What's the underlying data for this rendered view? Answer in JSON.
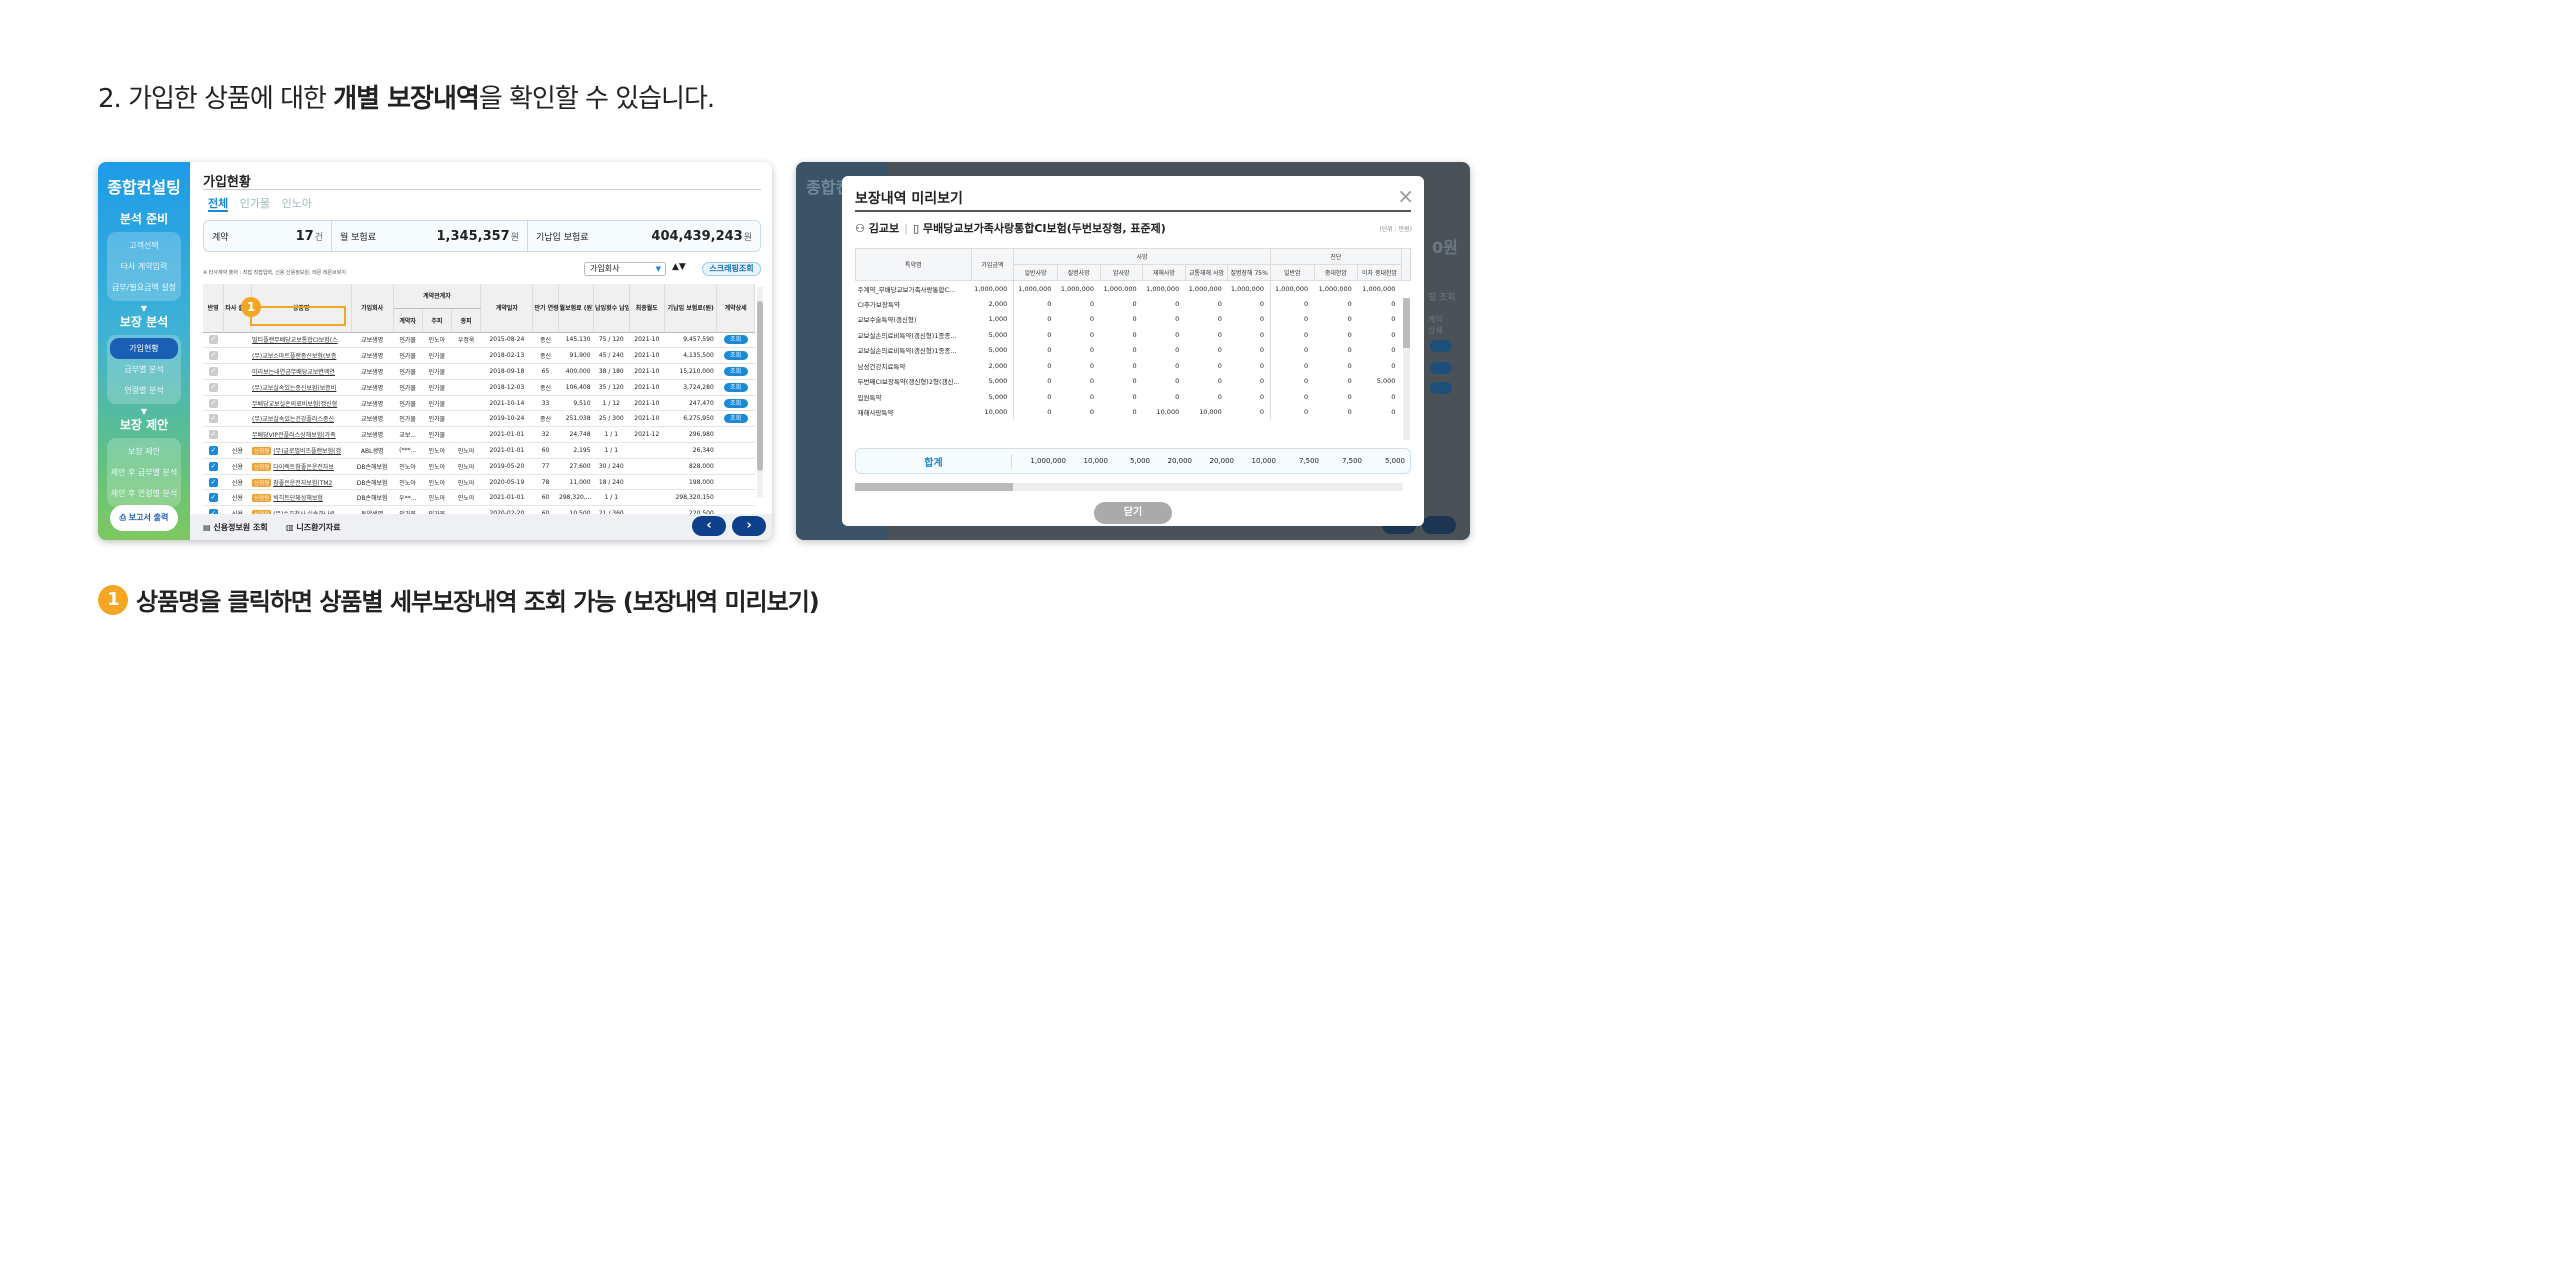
{
  "heading": {
    "prefix": "2. 가입한 상품에 대한 ",
    "bold": "개별 보장내역",
    "suffix": "을 확인할 수 있습니다."
  },
  "footnote": {
    "num": "1",
    "text": "상품명을 클릭하면 상품별 세부보장내역 조회 가능 (보장내역 미리보기)"
  },
  "sidebar": {
    "title": "종합컨설팅",
    "sections": [
      {
        "title": "분석 준비",
        "items": [
          "고객선택",
          "타사 계약입력",
          "급부/필요금액 설정"
        ]
      },
      {
        "title": "보장 분석",
        "items": [
          "가입현황",
          "급부별 분석",
          "연령별 분석"
        ]
      },
      {
        "title": "보장 제안",
        "items": [
          "보장 제안",
          "제안 후 급부별 분석",
          "제안 후 연령별 분석"
        ]
      }
    ],
    "active": "가입현황",
    "print": "보고서 출력"
  },
  "content": {
    "title": "가입현황",
    "tabs": [
      "전체",
      "인가물",
      "인노아"
    ],
    "summary": {
      "contract_label": "계약",
      "contract_value": "17",
      "contract_unit": "건",
      "monthly_label": "월 보험료",
      "monthly_value": "1,345,357",
      "monthly_unit": "원",
      "paid_label": "기납입 보험료",
      "paid_value": "404,439,243",
      "paid_unit": "원"
    },
    "note": "※ 타사계약 출처 : 직접 직접입력, 신용 신용정보원, 레몬 레몬브릿지",
    "insurer_select": "가입회사",
    "sort": "▲▼",
    "scrap_button": "스크래핑조회",
    "columns": [
      "반영",
      "타사 출처",
      "상품명",
      "가입회사",
      "계약자",
      "주피",
      "종피",
      "계약일자",
      "만기 연령",
      "월보험료 (원)",
      "납입횟수 납입/총횟수",
      "최종월도",
      "기납입 보험료(원)",
      "계약상세"
    ],
    "column_group": "계약관계자",
    "rows": [
      {
        "check": true,
        "src": "",
        "tag": "",
        "name": "멀티플랜무배당교보통합CI보험(스",
        "company": "교보생명",
        "owner": "인가물",
        "main": "인노아",
        "sub": "우정욱",
        "date": "2015-08-24",
        "age": "종신",
        "premium": "145,130",
        "count": "75 / 120",
        "last": "2021-10",
        "paid": "9,457,590",
        "view": "조회"
      },
      {
        "check": true,
        "src": "",
        "tag": "",
        "name": "(무)교보스마트플랜종신보험(보증",
        "company": "교보생명",
        "owner": "인가물",
        "main": "인가물",
        "sub": "",
        "date": "2018-02-13",
        "age": "종신",
        "premium": "91,900",
        "count": "45 / 240",
        "last": "2021-10",
        "paid": "4,135,500",
        "view": "조회"
      },
      {
        "check": true,
        "src": "",
        "tag": "",
        "name": "미리보는내연금무배당교보변액연",
        "company": "교보생명",
        "owner": "인가물",
        "main": "인가물",
        "sub": "",
        "date": "2018-09-18",
        "age": "65",
        "premium": "400,000",
        "count": "38 / 180",
        "last": "2021-10",
        "paid": "15,210,000",
        "view": "조회"
      },
      {
        "check": true,
        "src": "",
        "tag": "",
        "name": "(무)교보실속있는종신보험(보증비",
        "company": "교보생명",
        "owner": "인가물",
        "main": "인가물",
        "sub": "",
        "date": "2018-12-03",
        "age": "종신",
        "premium": "106,408",
        "count": "35 / 120",
        "last": "2021-10",
        "paid": "3,724,280",
        "view": "조회"
      },
      {
        "check": true,
        "src": "",
        "tag": "",
        "name": "무배당교보실손의료비보험(갱신형",
        "company": "교보생명",
        "owner": "인가물",
        "main": "인가물",
        "sub": "",
        "date": "2021-10-14",
        "age": "33",
        "premium": "9,510",
        "count": "1 / 12",
        "last": "2021-10",
        "paid": "247,470",
        "view": "조회"
      },
      {
        "check": true,
        "src": "",
        "tag": "",
        "name": "(무)교보실속있는건강플러스종신",
        "company": "교보생명",
        "owner": "인가물",
        "main": "인가물",
        "sub": "",
        "date": "2019-10-24",
        "age": "종신",
        "premium": "251,038",
        "count": "25 / 300",
        "last": "2021-10",
        "paid": "6,275,950",
        "view": "조회"
      },
      {
        "check": true,
        "src": "",
        "tag": "",
        "name": "무배당VIP전플러스상해보험(가족",
        "company": "교보생명",
        "owner": "교보...",
        "main": "인가물",
        "sub": "",
        "date": "2021-01-01",
        "age": "32",
        "premium": "24,748",
        "count": "1 / 1",
        "last": "2021-12",
        "paid": "296,980",
        "view": ""
      },
      {
        "check": true,
        "src": "신용",
        "tag": "신정원",
        "name": "(무)글로벌비즈플랜보험(갱",
        "company": "ABL생명",
        "owner": "(***...",
        "main": "인노아",
        "sub": "인노아",
        "date": "2021-01-01",
        "age": "60",
        "premium": "2,195",
        "count": "1 / 1",
        "last": "",
        "paid": "26,340",
        "view": ""
      },
      {
        "check": true,
        "src": "신용",
        "tag": "신정원",
        "name": "다이렉트참좋은운전자보",
        "company": "DB손해보험",
        "owner": "인노아",
        "main": "인노아",
        "sub": "인노아",
        "date": "2019-05-20",
        "age": "77",
        "premium": "27,600",
        "count": "30 / 240",
        "last": "",
        "paid": "828,000",
        "view": ""
      },
      {
        "check": true,
        "src": "신용",
        "tag": "신정원",
        "name": "참좋은운전자보험(TM2",
        "company": "DB손해보험",
        "owner": "인노아",
        "main": "인노아",
        "sub": "인노아",
        "date": "2020-05-19",
        "age": "78",
        "premium": "11,000",
        "count": "18 / 240",
        "last": "",
        "paid": "198,000",
        "view": ""
      },
      {
        "check": true,
        "src": "신용",
        "tag": "신정원",
        "name": "빅히트단체상해보험",
        "company": "DB손해보험",
        "owner": "우**...",
        "main": "인노아",
        "sub": "인노아",
        "date": "2021-01-01",
        "age": "60",
        "premium": "298,320,...",
        "count": "1 / 1",
        "last": "",
        "paid": "298,320,150",
        "view": ""
      },
      {
        "check": true,
        "src": "신용",
        "tag": "신정원",
        "name": "(무)수호천사 실속하나로",
        "company": "동양생명",
        "owner": "인가물",
        "main": "인가물",
        "sub": "",
        "date": "2020-02-20",
        "age": "60",
        "premium": "10,500",
        "count": "21 / 360",
        "last": "",
        "paid": "220,500",
        "view": ""
      }
    ],
    "marker": "1",
    "bottom_links": [
      "신용정보원 조회",
      "니즈환기자료"
    ]
  },
  "background_right": {
    "title": "종합컨설팅",
    "amount_fragment": "0원",
    "screen_fragment": "링 조회",
    "detail_fragment": "계약 상세",
    "view": "조회"
  },
  "modal": {
    "title": "보장내역 미리보기",
    "close": "×",
    "customer": "김교보",
    "product": "무배당교보가족사랑통합CI보험(두번보장형, 표준제)",
    "unit_note": "(단위 : 만원)",
    "group_death": "사망",
    "group_diagnosis": "진단",
    "col_name": "특약명",
    "col_amount": "가입금액",
    "col_headers": [
      "일반사망",
      "질병사망",
      "암사망",
      "재해사망",
      "교통재해 사망",
      "질병장해 75%",
      "일반암",
      "중대한암",
      "이차 중대한암"
    ],
    "rows": [
      {
        "name": "주계약_무배당교보가족사랑통합C...",
        "amount": "1,000,000",
        "v": [
          "1,000,000",
          "1,000,000",
          "1,000,000",
          "1,000,000",
          "1,000,000",
          "1,000,000",
          "1,000,000",
          "1,000,000",
          "1,000,000"
        ]
      },
      {
        "name": "CI추가보장특약",
        "amount": "2,000",
        "v": [
          "0",
          "0",
          "0",
          "0",
          "0",
          "0",
          "0",
          "0",
          "0"
        ]
      },
      {
        "name": "교보수술특약(갱신형)",
        "amount": "1,000",
        "v": [
          "0",
          "0",
          "0",
          "0",
          "0",
          "0",
          "0",
          "0",
          "0"
        ]
      },
      {
        "name": "교보실손의료비특약(갱신형)1종종...",
        "amount": "5,000",
        "v": [
          "0",
          "0",
          "0",
          "0",
          "0",
          "0",
          "0",
          "0",
          "0"
        ]
      },
      {
        "name": "교보실손의료비특약(갱신형)1종종...",
        "amount": "5,000",
        "v": [
          "0",
          "0",
          "0",
          "0",
          "0",
          "0",
          "0",
          "0",
          "0"
        ]
      },
      {
        "name": "남성건강치료특약",
        "amount": "2,000",
        "v": [
          "0",
          "0",
          "0",
          "0",
          "0",
          "0",
          "0",
          "0",
          "0"
        ]
      },
      {
        "name": "두번째CI보장특약(갱신형)2형(갱신...",
        "amount": "5,000",
        "v": [
          "0",
          "0",
          "0",
          "0",
          "0",
          "0",
          "0",
          "0",
          "5,000"
        ]
      },
      {
        "name": "입원특약",
        "amount": "5,000",
        "v": [
          "0",
          "0",
          "0",
          "0",
          "0",
          "0",
          "0",
          "0",
          "0"
        ]
      },
      {
        "name": "재해사망특약",
        "amount": "10,000",
        "v": [
          "0",
          "0",
          "0",
          "10,000",
          "10,000",
          "0",
          "0",
          "0",
          "0"
        ]
      }
    ],
    "total_label": "합계",
    "total_values": [
      "1,000,000",
      "10,000",
      "5,000",
      "20,000",
      "20,000",
      "10,000",
      "7,500",
      "7,500",
      "5,000"
    ],
    "close_button": "닫기"
  }
}
